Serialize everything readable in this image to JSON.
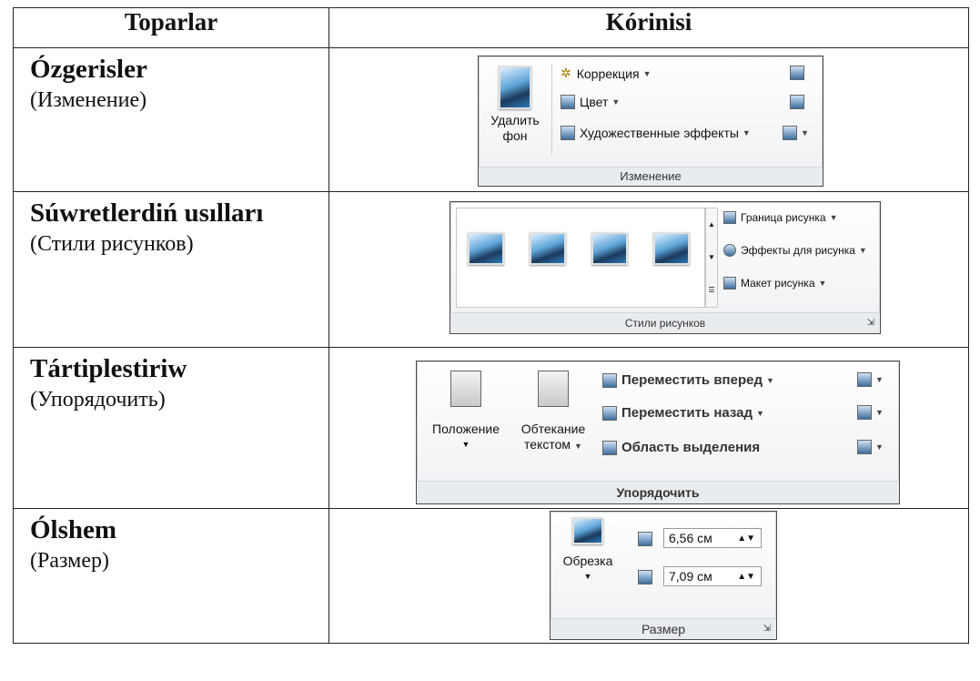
{
  "header": {
    "col1": "Toparlar",
    "col2": "Kórinisi"
  },
  "rows": [
    {
      "title": "Ózgerisler",
      "subtitle": "(Изменение)"
    },
    {
      "title": "Súwretlerdiń usılları",
      "subtitle": "(Стили рисунков)"
    },
    {
      "title": "Tártiplestiriw",
      "subtitle": "(Упорядочить)"
    },
    {
      "title": "Ólshem",
      "subtitle": "(Размер)"
    }
  ],
  "ribbon_izmenenie": {
    "remove_bg": [
      "Удалить",
      "фон"
    ],
    "correction": "Коррекция",
    "color": "Цвет",
    "effects": "Художественные эффекты",
    "group": "Изменение"
  },
  "ribbon_styles": {
    "border": "Граница рисунка",
    "effects": "Эффекты для рисунка",
    "layout": "Макет рисунка",
    "group": "Стили рисунков"
  },
  "ribbon_arrange": {
    "position": "Положение",
    "wrap": [
      "Обтекание",
      "текстом"
    ],
    "forward": "Переместить вперед",
    "backward": "Переместить назад",
    "selection": "Область выделения",
    "group": "Упорядочить"
  },
  "ribbon_size": {
    "crop": "Обрезка",
    "height": "6,56 см",
    "width": "7,09 см",
    "group": "Размер"
  }
}
